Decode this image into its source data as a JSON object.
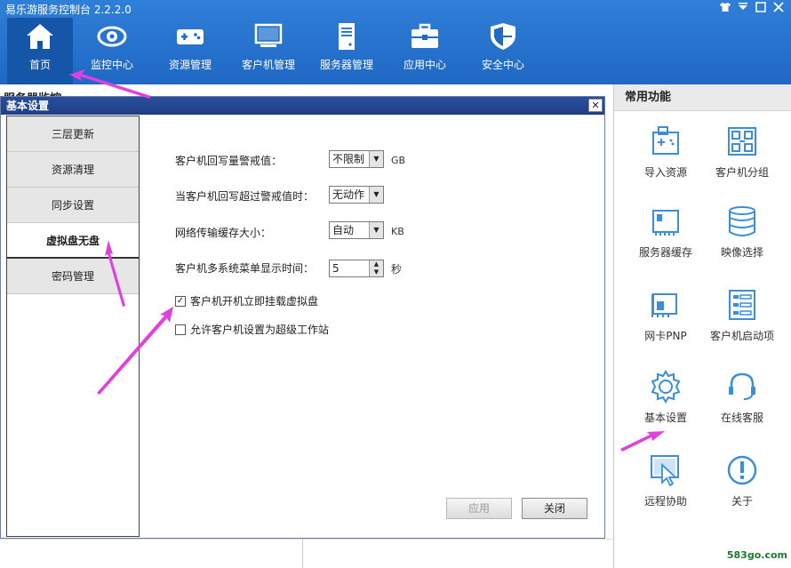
{
  "app": {
    "title": "易乐游服务控制台 2.2.2.0",
    "window_controls": [
      "shirt-icon",
      "minimize-icon",
      "maximize-icon",
      "close-icon"
    ]
  },
  "nav": [
    {
      "label": "首页",
      "icon": "home-icon",
      "active": true
    },
    {
      "label": "监控中心",
      "icon": "eye-icon"
    },
    {
      "label": "资源管理",
      "icon": "gamepad-icon"
    },
    {
      "label": "客户机管理",
      "icon": "monitor-icon"
    },
    {
      "label": "服务器管理",
      "icon": "server-icon"
    },
    {
      "label": "应用中心",
      "icon": "toolbox-icon"
    },
    {
      "label": "安全中心",
      "icon": "shield-icon"
    }
  ],
  "background": {
    "section_title": "服务器监控"
  },
  "right_panel": {
    "header": "常用功能",
    "items": [
      {
        "label": "导入资源",
        "icon": "import-resource-icon"
      },
      {
        "label": "客户机分组",
        "icon": "client-group-icon"
      },
      {
        "label": "服务器缓存",
        "icon": "server-cache-icon"
      },
      {
        "label": "映像选择",
        "icon": "image-select-icon"
      },
      {
        "label": "网卡PNP",
        "icon": "network-card-icon"
      },
      {
        "label": "客户机启动项",
        "icon": "client-boot-icon"
      },
      {
        "label": "基本设置",
        "icon": "gear-icon"
      },
      {
        "label": "在线客服",
        "icon": "headset-icon"
      },
      {
        "label": "远程协助",
        "icon": "remote-assist-icon"
      },
      {
        "label": "关于",
        "icon": "info-icon"
      }
    ]
  },
  "dialog": {
    "title": "基本设置",
    "close": "✕",
    "tabs": [
      {
        "label": "三层更新"
      },
      {
        "label": "资源清理"
      },
      {
        "label": "同步设置"
      },
      {
        "label": "虚拟盘无盘",
        "active": true
      },
      {
        "label": "密码管理"
      }
    ],
    "fields": {
      "writeback_warn": {
        "label": "客户机回写量警戒值：",
        "value": "不限制",
        "unit": "GB"
      },
      "writeback_action": {
        "label": "当客户机回写超过警戒值时：",
        "value": "无动作"
      },
      "net_cache": {
        "label": "网络传输缓存大小：",
        "value": "自动",
        "unit": "KB"
      },
      "menu_time": {
        "label": "客户机多系统菜单显示时间：",
        "value": "5",
        "unit": "秒"
      }
    },
    "checks": [
      {
        "label": "客户机开机立即挂载虚拟盘",
        "checked": true
      },
      {
        "label": "允许客户机设置为超级工作站",
        "checked": false
      }
    ],
    "buttons": {
      "apply": "应用",
      "close": "关闭"
    }
  },
  "watermark": "583go.com",
  "colors": {
    "topbar": "#2274cf",
    "active_nav": "#1656a8",
    "annotation": "#e040e0",
    "dialog_title": "#23468f"
  }
}
